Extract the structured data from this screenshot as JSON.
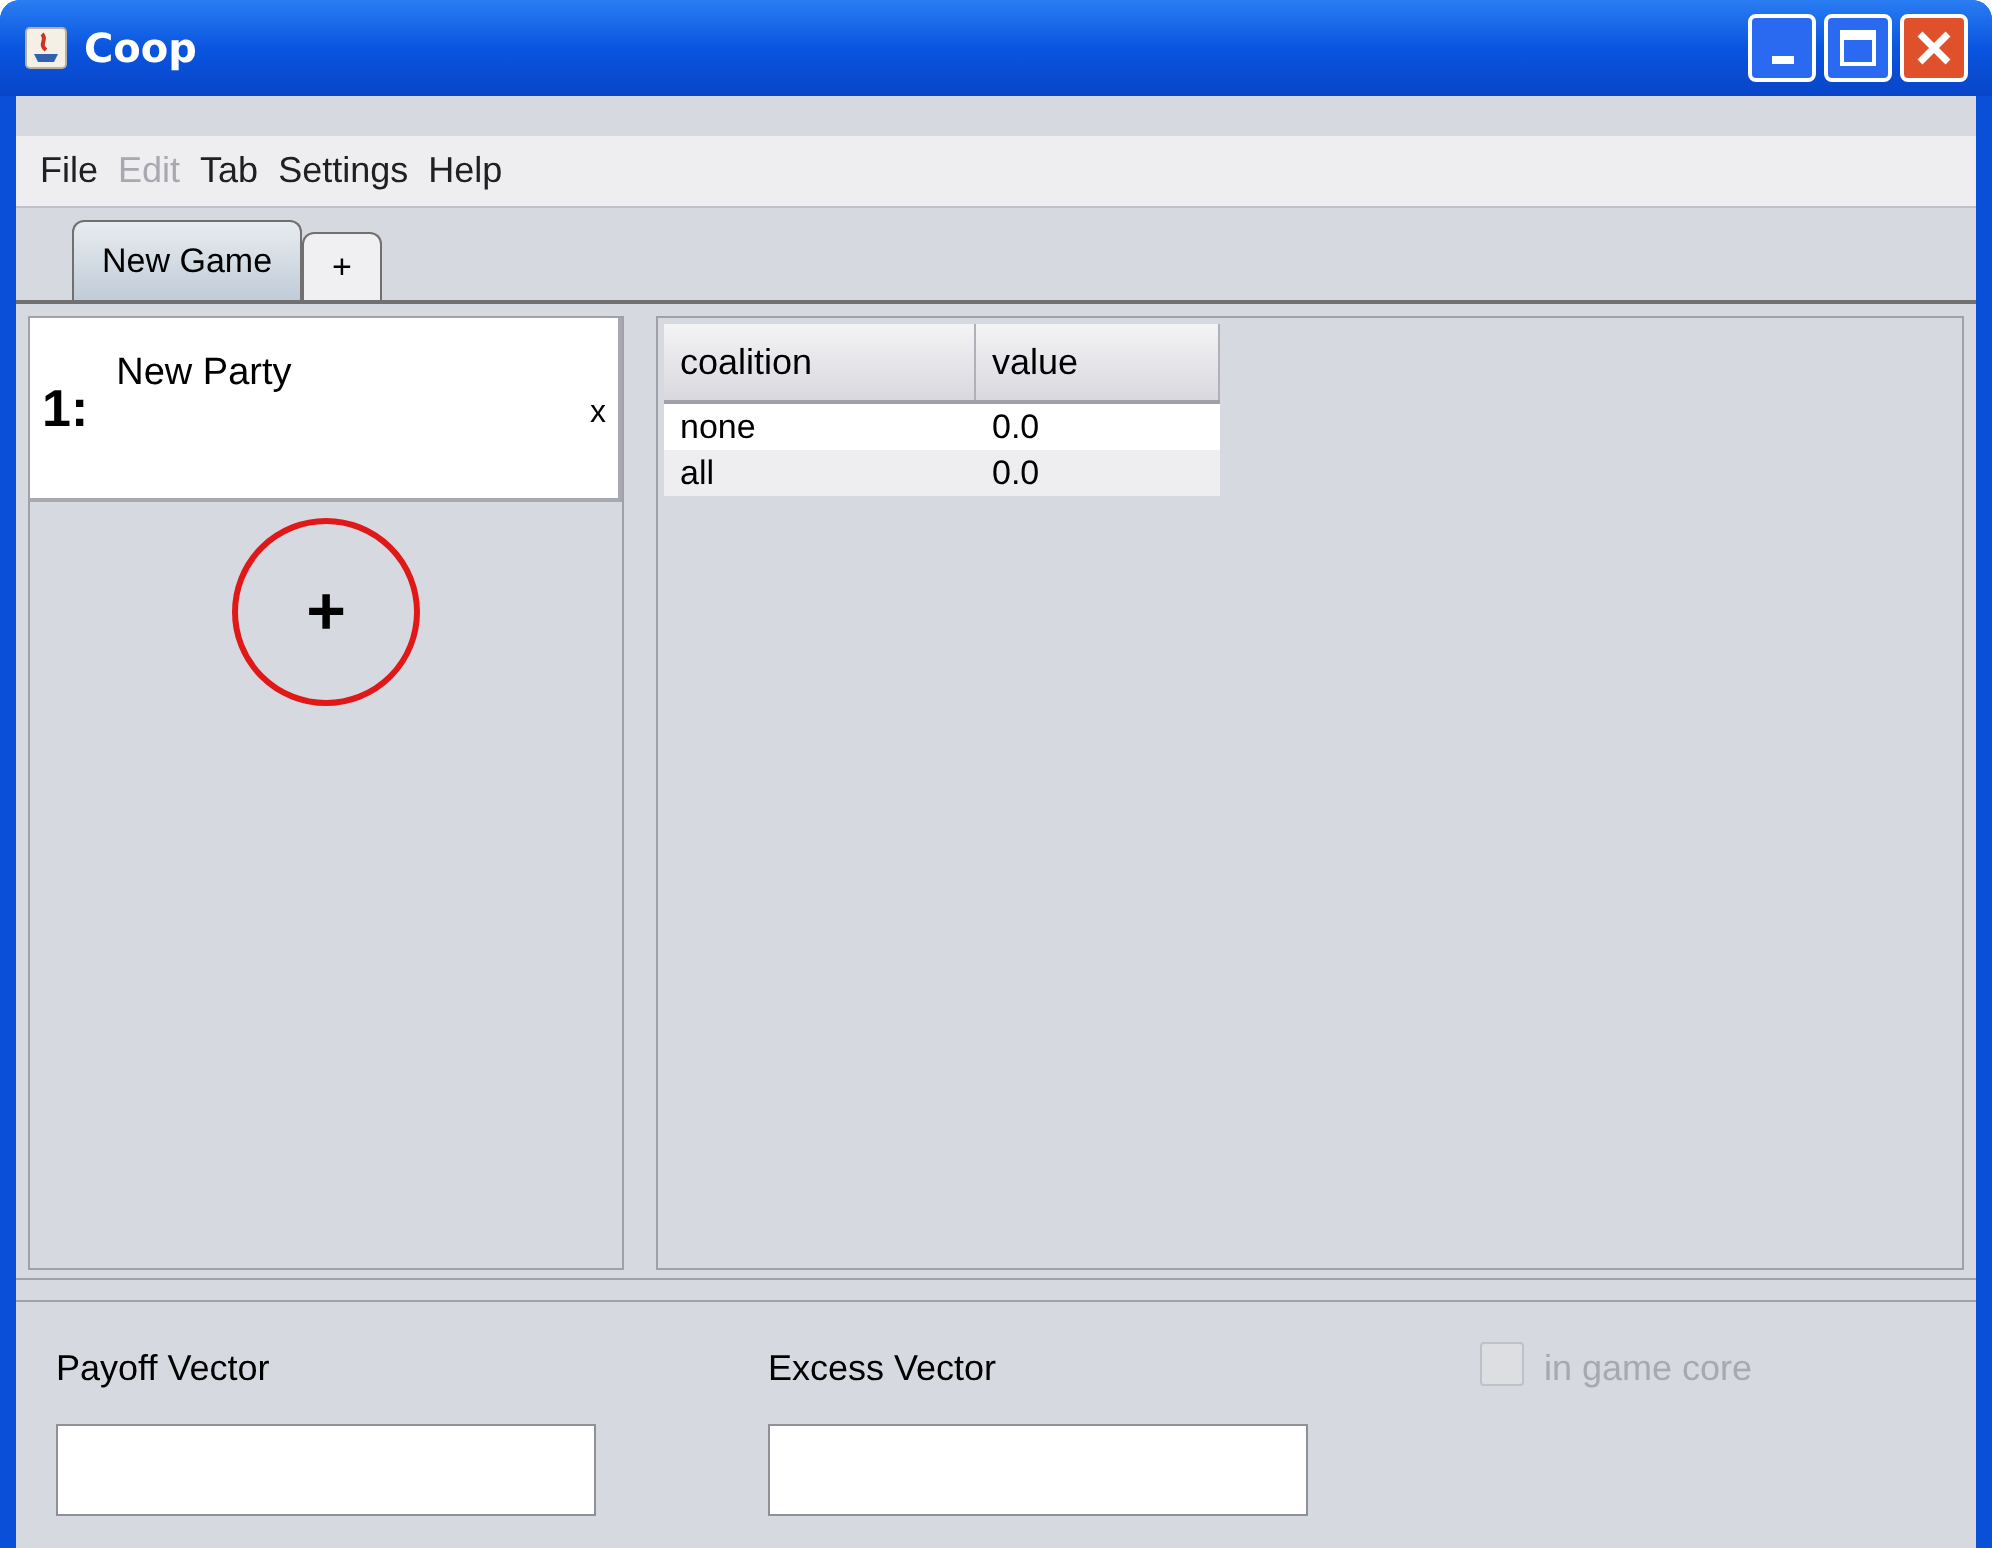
{
  "window": {
    "title": "Coop"
  },
  "menu": [
    {
      "label": "File",
      "disabled": false
    },
    {
      "label": "Edit",
      "disabled": true
    },
    {
      "label": "Tab",
      "disabled": false
    },
    {
      "label": "Settings",
      "disabled": false
    },
    {
      "label": "Help",
      "disabled": false
    }
  ],
  "tabs": [
    {
      "label": "New Game",
      "selected": true
    },
    {
      "label": "+",
      "selected": false
    }
  ],
  "parties": [
    {
      "number": "1:",
      "name": "New Party",
      "close": "x"
    }
  ],
  "add_party": {
    "label": "+"
  },
  "table": {
    "columns": [
      "coalition",
      "value"
    ],
    "rows": [
      [
        "none",
        "0.0"
      ],
      [
        "all",
        "0.0"
      ]
    ]
  },
  "bottom": {
    "payoff_label": "Payoff Vector",
    "excess_label": "Excess Vector",
    "in_core": {
      "label": "in game core",
      "checked": false,
      "disabled": true
    }
  }
}
